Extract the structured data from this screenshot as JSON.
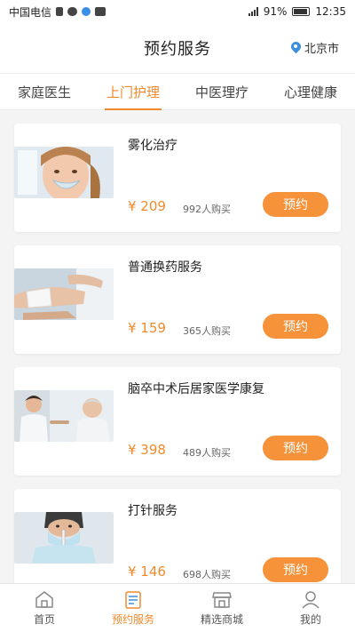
{
  "status_bar": {
    "carrier": "中国电信",
    "battery": "91%",
    "time": "12:35"
  },
  "header": {
    "title": "预约服务",
    "city": "北京市"
  },
  "tabs": [
    {
      "label": "家庭医生",
      "active": false
    },
    {
      "label": "上门护理",
      "active": true
    },
    {
      "label": "中医理疗",
      "active": false
    },
    {
      "label": "心理健康",
      "active": false
    }
  ],
  "services": [
    {
      "title": "雾化治疗",
      "price": "¥ 209",
      "sold": "992人购买",
      "button": "预约",
      "image": "child-nebulizer-photo"
    },
    {
      "title": "普通换药服务",
      "price": "¥ 159",
      "sold": "365人购买",
      "button": "预约",
      "image": "hand-bandage-photo"
    },
    {
      "title": "脑卒中术后居家医学康复",
      "price": "¥ 398",
      "sold": "489人购买",
      "button": "预约",
      "image": "doctor-elderly-patient-photo"
    },
    {
      "title": "打针服务",
      "price": "¥ 146",
      "sold": "698人购买",
      "button": "预约",
      "image": "nurse-syringe-photo"
    }
  ],
  "bottom_nav": [
    {
      "label": "首页",
      "icon": "home-icon",
      "active": false
    },
    {
      "label": "预约服务",
      "icon": "calendar-icon",
      "active": true
    },
    {
      "label": "精选商城",
      "icon": "store-icon",
      "active": false
    },
    {
      "label": "我的",
      "icon": "user-icon",
      "active": false
    }
  ],
  "colors": {
    "accent": "#f08a2c",
    "button": "#f5923a",
    "pin": "#3d8fe0"
  }
}
